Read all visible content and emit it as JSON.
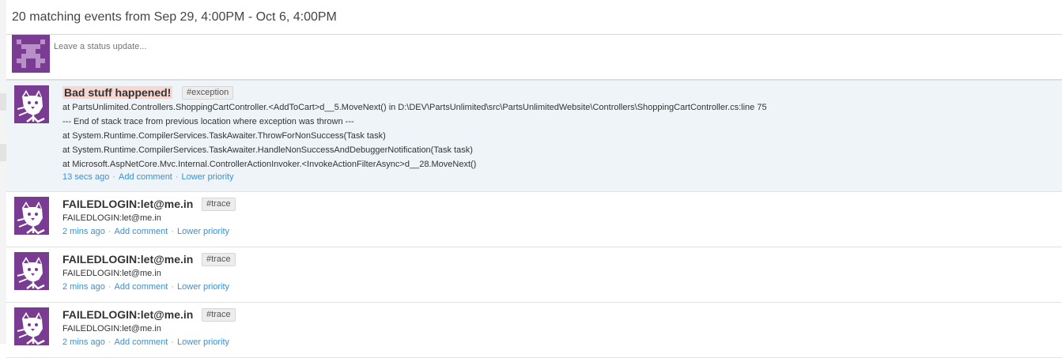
{
  "header": {
    "title": "20 matching events from Sep 29, 4:00PM - Oct 6, 4:00PM"
  },
  "status_update": {
    "placeholder": "Leave a status update..."
  },
  "colors": {
    "avatar_purple": "#7a3c92",
    "link_blue": "#3d8fce",
    "highlight_bg": "#eef4f8",
    "alert_bg": "#f7d7d2"
  },
  "events": [
    {
      "title": "Bad stuff happened!",
      "tag": "#exception",
      "lines": [
        "at PartsUnlimited.Controllers.ShoppingCartController.<AddToCart>d__5.MoveNext() in D:\\DEV\\PartsUnlimited\\src\\PartsUnlimitedWebsite\\Controllers\\ShoppingCartController.cs:line 75",
        "--- End of stack trace from previous location where exception was thrown ---",
        "at System.Runtime.CompilerServices.TaskAwaiter.ThrowForNonSuccess(Task task)",
        "at System.Runtime.CompilerServices.TaskAwaiter.HandleNonSuccessAndDebuggerNotification(Task task)",
        "at Microsoft.AspNetCore.Mvc.Internal.ControllerActionInvoker.<InvokeActionFilterAsync>d__28.MoveNext()"
      ],
      "time": "13 secs ago",
      "add_comment": "Add comment",
      "lower_priority": "Lower priority"
    },
    {
      "title": "FAILEDLOGIN:let@me.in",
      "tag": "#trace",
      "lines": [
        "FAILEDLOGIN:let@me.in"
      ],
      "time": "2 mins ago",
      "add_comment": "Add comment",
      "lower_priority": "Lower priority"
    },
    {
      "title": "FAILEDLOGIN:let@me.in",
      "tag": "#trace",
      "lines": [
        "FAILEDLOGIN:let@me.in"
      ],
      "time": "2 mins ago",
      "add_comment": "Add comment",
      "lower_priority": "Lower priority"
    },
    {
      "title": "FAILEDLOGIN:let@me.in",
      "tag": "#trace",
      "lines": [
        "FAILEDLOGIN:let@me.in"
      ],
      "time": "2 mins ago",
      "add_comment": "Add comment",
      "lower_priority": "Lower priority"
    }
  ]
}
